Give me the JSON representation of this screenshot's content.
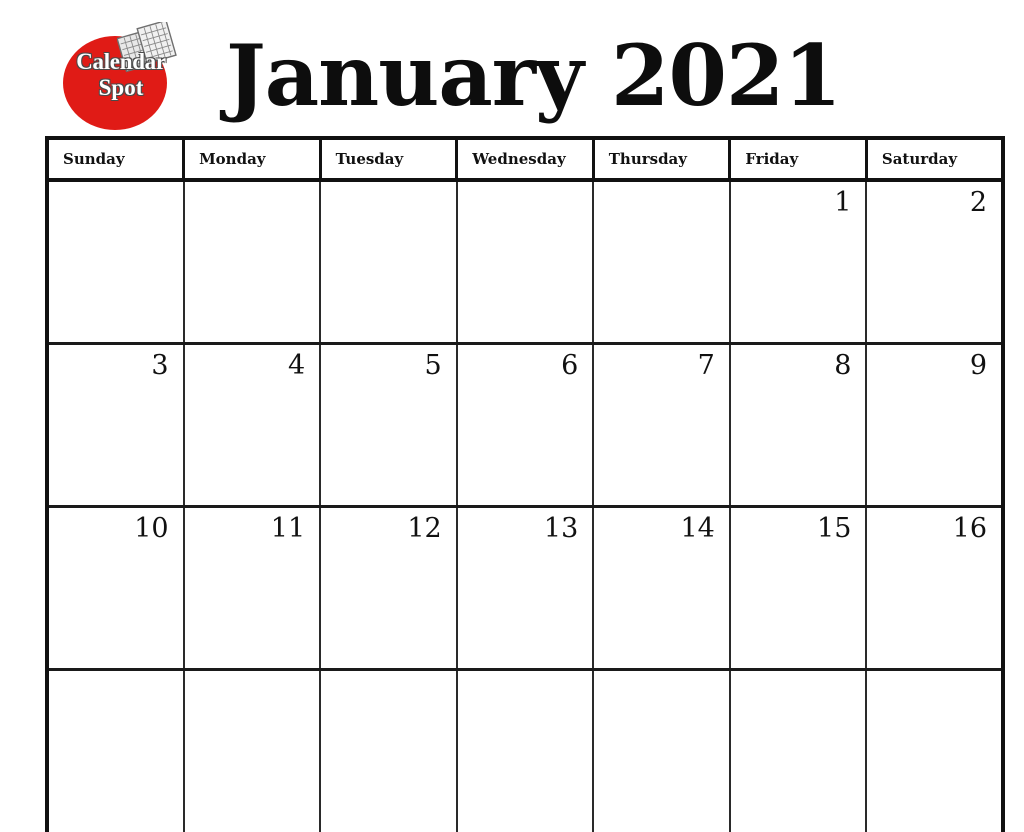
{
  "brand": {
    "name_line1": "Calendar",
    "name_line2": "Spot",
    "logo_color": "#e01b16",
    "logo_icon": "calendar-pages-icon"
  },
  "header": {
    "title": "January 2021",
    "month": "January",
    "year": "2021"
  },
  "calendar": {
    "weekday_headers": [
      "Sunday",
      "Monday",
      "Tuesday",
      "Wednesday",
      "Thursday",
      "Friday",
      "Saturday"
    ],
    "weeks": [
      [
        "",
        "",
        "",
        "",
        "",
        "1",
        "2"
      ],
      [
        "3",
        "4",
        "5",
        "6",
        "7",
        "8",
        "9"
      ],
      [
        "10",
        "11",
        "12",
        "13",
        "14",
        "15",
        "16"
      ],
      [
        "",
        "",
        "",
        "",
        "",
        "",
        ""
      ]
    ]
  }
}
